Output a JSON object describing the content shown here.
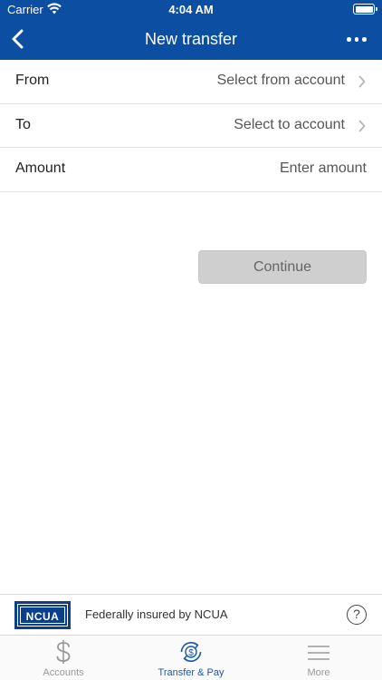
{
  "status_bar": {
    "carrier": "Carrier",
    "time": "4:04 AM"
  },
  "nav": {
    "title": "New transfer",
    "back_icon": "chevron-left-icon",
    "more_icon": "ellipsis-icon"
  },
  "form": {
    "from": {
      "label": "From",
      "value": "Select from account"
    },
    "to": {
      "label": "To",
      "value": "Select to account"
    },
    "amount": {
      "label": "Amount",
      "placeholder": "Enter amount"
    }
  },
  "continue_button": {
    "label": "Continue",
    "enabled": false
  },
  "footer": {
    "logo_text": "NCUA",
    "insured_text": "Federally insured by NCUA",
    "help_label": "?"
  },
  "tabs": [
    {
      "label": "Accounts",
      "icon": "dollar-icon",
      "active": false
    },
    {
      "label": "Transfer & Pay",
      "icon": "transfer-pay-icon",
      "active": true
    },
    {
      "label": "More",
      "icon": "menu-icon",
      "active": false
    }
  ],
  "colors": {
    "header": "#0b4ea2",
    "active_tab": "#1a5aa8",
    "inactive_tab": "#999999",
    "button_disabled": "#cfcfcf"
  }
}
